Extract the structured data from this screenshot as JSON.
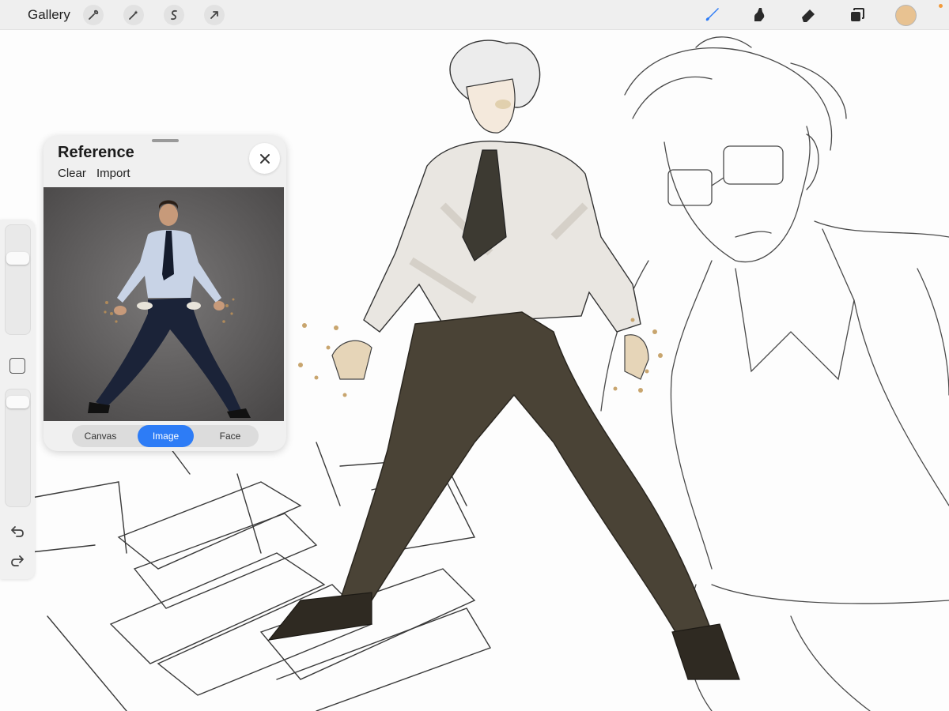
{
  "topbar": {
    "gallery_label": "Gallery",
    "left_tools": [
      {
        "name": "actions",
        "icon": "wrench-icon"
      },
      {
        "name": "adjustments",
        "icon": "magic-wand-icon"
      },
      {
        "name": "selection",
        "icon": "selection-s-icon"
      },
      {
        "name": "transform",
        "icon": "arrow-cursor-icon"
      }
    ],
    "right_tools": [
      {
        "name": "brush",
        "icon": "brush-icon",
        "active": true
      },
      {
        "name": "smudge",
        "icon": "smudge-icon"
      },
      {
        "name": "eraser",
        "icon": "eraser-icon"
      },
      {
        "name": "layers",
        "icon": "layers-icon"
      }
    ],
    "current_color": "#e8c291",
    "active_tool_color": "#2d7cf6"
  },
  "sidebar": {
    "brush_size_level": 0.27,
    "opacity_level": 0.05,
    "modify_icon": "square-icon",
    "undo_icon": "undo-icon",
    "redo_icon": "redo-icon"
  },
  "reference": {
    "title": "Reference",
    "clear_label": "Clear",
    "import_label": "Import",
    "close_icon": "close-x-icon",
    "tabs": [
      {
        "label": "Canvas",
        "active": false
      },
      {
        "label": "Image",
        "active": true
      },
      {
        "label": "Face",
        "active": false
      }
    ]
  }
}
